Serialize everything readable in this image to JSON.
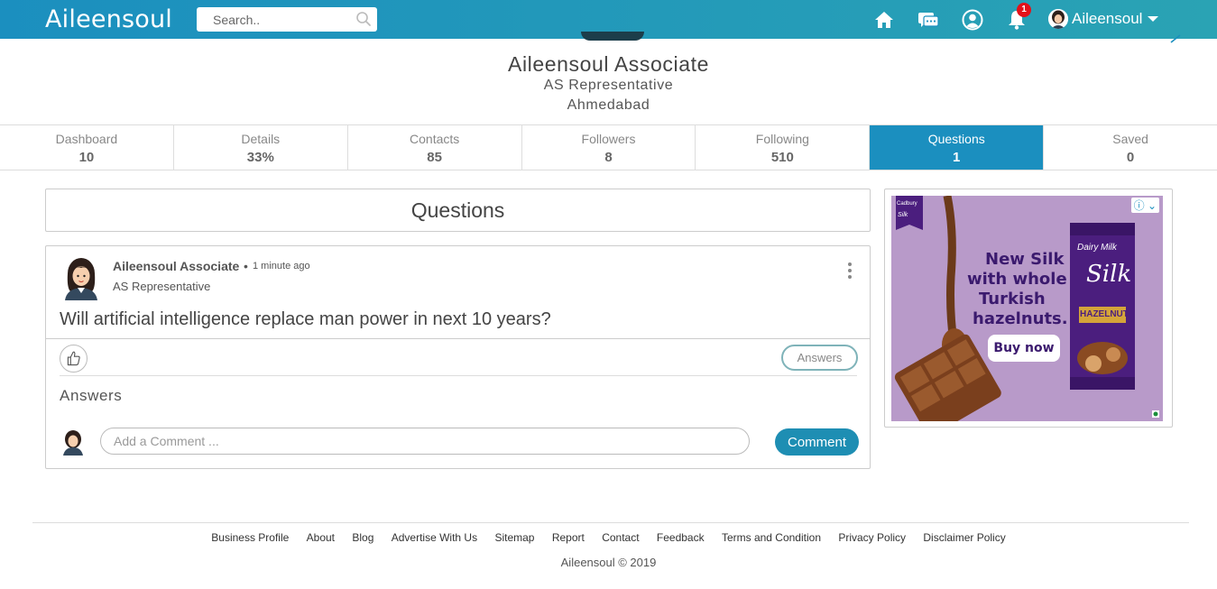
{
  "header": {
    "brand": "Aileensoul",
    "search_placeholder": "Search..",
    "notification_count": "1",
    "user_name": "Aileensoul",
    "icons": [
      "home-icon",
      "messages-icon",
      "contacts-icon",
      "bell-icon",
      "user-avatar",
      "chevron-down-icon"
    ],
    "colors": {
      "bar": "#1b8fbf",
      "badge": "#e3111a"
    }
  },
  "profile": {
    "name": "Aileensoul Associate",
    "title": "AS Representative",
    "city": "Ahmedabad"
  },
  "stats": [
    {
      "label": "Dashboard",
      "value": "10"
    },
    {
      "label": "Details",
      "value": "33%"
    },
    {
      "label": "Contacts",
      "value": "85"
    },
    {
      "label": "Followers",
      "value": "8"
    },
    {
      "label": "Following",
      "value": "510"
    },
    {
      "label": "Questions",
      "value": "1",
      "active": true
    },
    {
      "label": "Saved",
      "value": "0"
    }
  ],
  "questions_section": {
    "heading": "Questions",
    "post": {
      "author": "Aileensoul Associate",
      "separator": "•",
      "time": "1 minute ago",
      "role": "AS Representative",
      "question": "Will artificial intelligence replace man power in next 10 years?",
      "answers_button": "Answers",
      "answers_heading": "Answers",
      "comment_placeholder": "Add a Comment ...",
      "comment_button": "Comment"
    }
  },
  "ad": {
    "headline": [
      "New Silk",
      "with whole",
      "Turkish",
      "hazelnuts."
    ],
    "cta": "Buy now",
    "product_brand": "Dairy Milk",
    "product_name": "Silk",
    "product_variant": "HAZELNUT",
    "maker": "Cadbury",
    "info_label": "ⓘ ⌄"
  },
  "footer": {
    "links": [
      "Business Profile",
      "About",
      "Blog",
      "Advertise With Us",
      "Sitemap",
      "Report",
      "Contact",
      "Feedback",
      "Terms and Condition",
      "Privacy Policy",
      "Disclaimer Policy"
    ],
    "copyright": "Aileensoul © 2019"
  }
}
